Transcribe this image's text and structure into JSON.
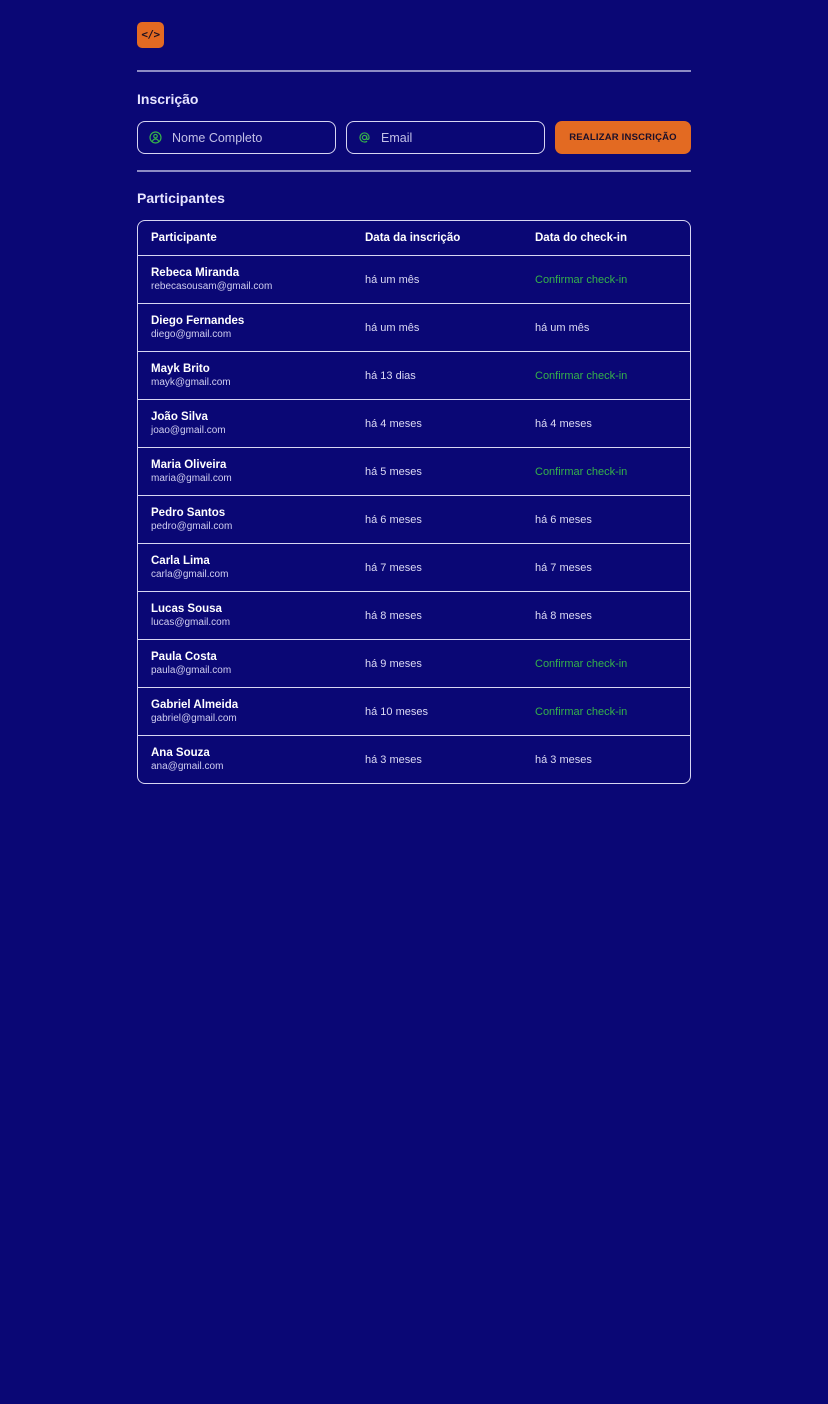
{
  "brand": {
    "logo_text": "</>",
    "accent_color": "#e36a22",
    "background_color": "#0a0775",
    "link_color": "#35b24a"
  },
  "registration": {
    "title": "Inscrição",
    "name_placeholder": "Nome Completo",
    "name_icon": "user-circle-icon",
    "email_placeholder": "Email",
    "email_icon": "at-sign-icon",
    "submit_label": "REALIZAR INSCRIÇÃO"
  },
  "participants": {
    "title": "Participantes",
    "columns": [
      "Participante",
      "Data da inscrição",
      "Data do check-in"
    ],
    "rows": [
      {
        "name": "Rebeca Miranda",
        "email": "rebecasousam@gmail.com",
        "registered": "há um mês",
        "checkin": "Confirmar check-in",
        "checked_in": false
      },
      {
        "name": "Diego Fernandes",
        "email": "diego@gmail.com",
        "registered": "há um mês",
        "checkin": "há um mês",
        "checked_in": true
      },
      {
        "name": "Mayk Brito",
        "email": "mayk@gmail.com",
        "registered": "há 13 dias",
        "checkin": "Confirmar check-in",
        "checked_in": false
      },
      {
        "name": "João Silva",
        "email": "joao@gmail.com",
        "registered": "há 4 meses",
        "checkin": "há 4 meses",
        "checked_in": true
      },
      {
        "name": "Maria Oliveira",
        "email": "maria@gmail.com",
        "registered": "há 5 meses",
        "checkin": "Confirmar check-in",
        "checked_in": false
      },
      {
        "name": "Pedro Santos",
        "email": "pedro@gmail.com",
        "registered": "há 6 meses",
        "checkin": "há 6 meses",
        "checked_in": true
      },
      {
        "name": "Carla Lima",
        "email": "carla@gmail.com",
        "registered": "há 7 meses",
        "checkin": "há 7 meses",
        "checked_in": true
      },
      {
        "name": "Lucas Sousa",
        "email": "lucas@gmail.com",
        "registered": "há 8 meses",
        "checkin": "há 8 meses",
        "checked_in": true
      },
      {
        "name": "Paula Costa",
        "email": "paula@gmail.com",
        "registered": "há 9 meses",
        "checkin": "Confirmar check-in",
        "checked_in": false
      },
      {
        "name": "Gabriel Almeida",
        "email": "gabriel@gmail.com",
        "registered": "há 10 meses",
        "checkin": "Confirmar check-in",
        "checked_in": false
      },
      {
        "name": "Ana Souza",
        "email": "ana@gmail.com",
        "registered": "há 3 meses",
        "checkin": "há 3 meses",
        "checked_in": true
      }
    ]
  }
}
